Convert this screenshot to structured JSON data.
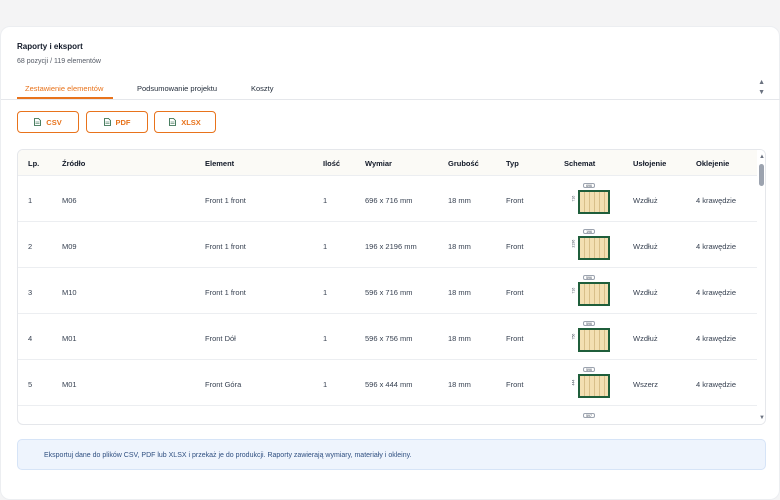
{
  "header": {
    "title": "Raporty i eksport",
    "subtitle": "68 pozycji / 119 elementów"
  },
  "tabs": [
    {
      "label": "Zestawienie elementów",
      "active": true
    },
    {
      "label": "Podsumowanie projektu",
      "active": false
    },
    {
      "label": "Koszty",
      "active": false
    }
  ],
  "export": {
    "csv": "CSV",
    "pdf": "PDF",
    "xlsx": "XLSX"
  },
  "table": {
    "columns": [
      "Lp.",
      "Źródło",
      "Element",
      "Ilość",
      "Wymiar",
      "Grubość",
      "Typ",
      "Schemat",
      "Usłojenie",
      "Oklejenie"
    ],
    "rows": [
      {
        "lp": "1",
        "source": "M06",
        "element": "Front 1 front",
        "qty": "1",
        "dim": "696 x 716 mm",
        "thickness": "18 mm",
        "type": "Front",
        "sw": "696",
        "sh": "716",
        "grain": "Wzdłuż",
        "edge": "4 krawędzie"
      },
      {
        "lp": "2",
        "source": "M09",
        "element": "Front 1 front",
        "qty": "1",
        "dim": "196 x 2196 mm",
        "thickness": "18 mm",
        "type": "Front",
        "sw": "196",
        "sh": "2196",
        "grain": "Wzdłuż",
        "edge": "4 krawędzie"
      },
      {
        "lp": "3",
        "source": "M10",
        "element": "Front 1 front",
        "qty": "1",
        "dim": "596 x 716 mm",
        "thickness": "18 mm",
        "type": "Front",
        "sw": "596",
        "sh": "716",
        "grain": "Wzdłuż",
        "edge": "4 krawędzie"
      },
      {
        "lp": "4",
        "source": "M01",
        "element": "Front Dół",
        "qty": "1",
        "dim": "596 x 756 mm",
        "thickness": "18 mm",
        "type": "Front",
        "sw": "596",
        "sh": "756",
        "grain": "Wzdłuż",
        "edge": "4 krawędzie"
      },
      {
        "lp": "5",
        "source": "M01",
        "element": "Front Góra",
        "qty": "1",
        "dim": "596 x 444 mm",
        "thickness": "18 mm",
        "type": "Front",
        "sw": "596",
        "sh": "444",
        "grain": "Wszerz",
        "edge": "4 krawędzie"
      }
    ],
    "partial_row_badge": "597"
  },
  "info": {
    "text": "Eksportuj dane do plików CSV, PDF lub XLSX i przekaż je do produkcji. Raporty zawierają wymiary, materiały i okleiny."
  },
  "colors": {
    "accent": "#e8731c",
    "board_border": "#1f5e3b"
  }
}
